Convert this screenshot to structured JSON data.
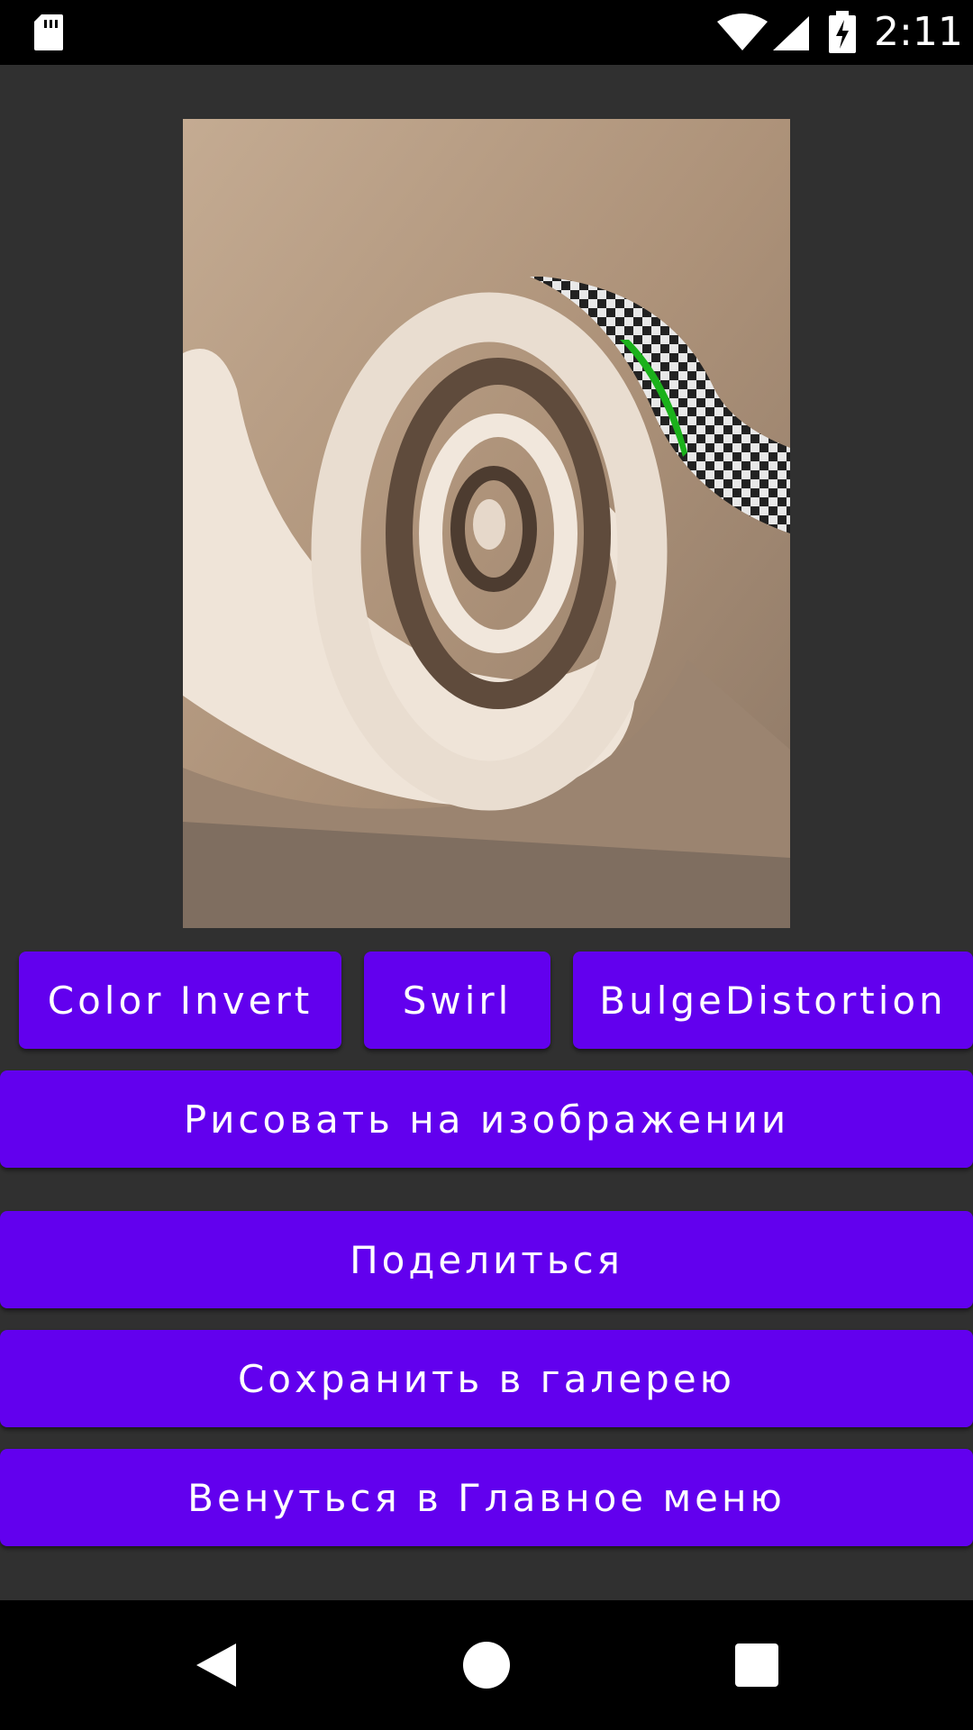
{
  "status_bar": {
    "time": "2:11",
    "icons": [
      "sd-card-icon",
      "wifi-icon",
      "cell-signal-icon",
      "battery-charging-icon"
    ]
  },
  "image_preview": {
    "description_icon": "swirl-distorted-image"
  },
  "filters": {
    "color_invert_label": "Color Invert",
    "swirl_label": "Swirl",
    "bulge_label": "BulgeDistortion"
  },
  "actions": {
    "draw_label": "Рисовать на изображении",
    "share_label": "Поделиться",
    "save_label": "Сохранить в галерею",
    "back_label": "Венуться в Главное меню"
  },
  "nav_bar": {
    "icons": [
      "back-icon",
      "home-icon",
      "recents-icon"
    ]
  },
  "colors": {
    "accent": "#6200ee",
    "background": "#303030",
    "system_bars": "#000000"
  }
}
